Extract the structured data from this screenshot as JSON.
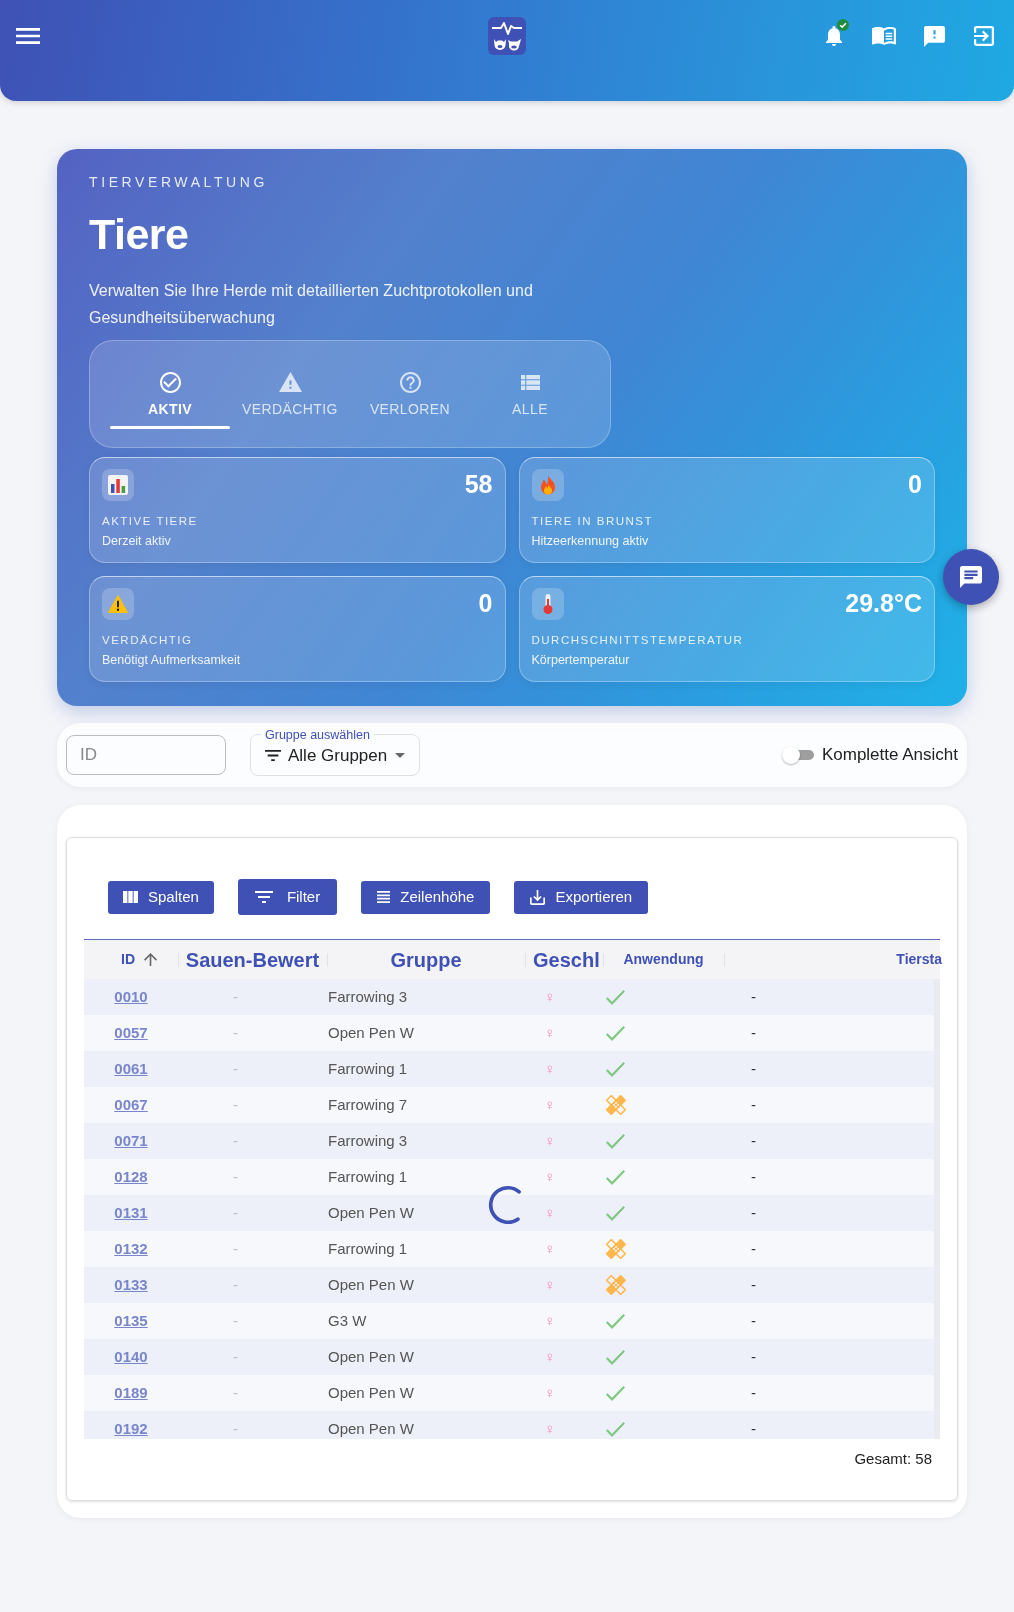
{
  "hero": {
    "eyebrow": "TIERVERWALTUNG",
    "title": "Tiere",
    "description": "Verwalten Sie Ihre Herde mit detaillierten Zuchtprotokollen und Gesundheitsüberwachung",
    "tabs": [
      {
        "label": "AKTIV",
        "selected": true
      },
      {
        "label": "VERDÄCHTIG",
        "selected": false
      },
      {
        "label": "VERLOREN",
        "selected": false
      },
      {
        "label": "ALLE",
        "selected": false
      }
    ],
    "stats": [
      {
        "value": "58",
        "label": "AKTIVE TIERE",
        "caption": "Derzeit aktiv"
      },
      {
        "value": "0",
        "label": "TIERE IN BRUNST",
        "caption": "Hitzeerkennung aktiv"
      },
      {
        "value": "0",
        "label": "VERDÄCHTIG",
        "caption": "Benötigt Aufmerksamkeit"
      },
      {
        "value": "29.8°C",
        "label": "DURCHSCHNITTSTEMPERATUR",
        "caption": "Körpertemperatur"
      }
    ]
  },
  "filters": {
    "id_field": {
      "placeholder": "ID"
    },
    "group_select": {
      "label": "Gruppe auswählen",
      "value": "Alle Gruppen"
    },
    "full_view": {
      "label": "Komplette Ansicht",
      "on": false
    }
  },
  "table": {
    "toolbar": [
      "Spalten",
      "Filter",
      "Zeilenhöhe",
      "Exportieren"
    ],
    "columns": [
      {
        "label": "ID",
        "sorted": true
      },
      {
        "label": "Sauen-Bewert",
        "sorted": false
      },
      {
        "label": "Gruppe",
        "sorted": false
      },
      {
        "label": "Geschl",
        "sorted": false
      },
      {
        "label": "Anwendung",
        "sorted": false
      },
      {
        "label": "Tiersta",
        "sorted": false
      }
    ],
    "rows": [
      {
        "id": "0010",
        "sauen_bewert": "-",
        "gruppe": "Farrowing 3",
        "geschl": "♀",
        "treated": false,
        "column_6": "-"
      },
      {
        "id": "0057",
        "sauen_bewert": "-",
        "gruppe": "Open Pen W",
        "geschl": "♀",
        "treated": false,
        "column_6": "-"
      },
      {
        "id": "0061",
        "sauen_bewert": "-",
        "gruppe": "Farrowing 1",
        "geschl": "♀",
        "treated": false,
        "column_6": "-"
      },
      {
        "id": "0067",
        "sauen_bewert": "-",
        "gruppe": "Farrowing 7",
        "geschl": "♀",
        "treated": true,
        "column_6": "-"
      },
      {
        "id": "0071",
        "sauen_bewert": "-",
        "gruppe": "Farrowing 3",
        "geschl": "♀",
        "treated": false,
        "column_6": "-"
      },
      {
        "id": "0128",
        "sauen_bewert": "-",
        "gruppe": "Farrowing 1",
        "geschl": "♀",
        "treated": false,
        "column_6": "-"
      },
      {
        "id": "0131",
        "sauen_bewert": "-",
        "gruppe": "Open Pen W",
        "geschl": "♀",
        "treated": false,
        "column_6": "-"
      },
      {
        "id": "0132",
        "sauen_bewert": "-",
        "gruppe": "Farrowing 1",
        "geschl": "♀",
        "treated": true,
        "column_6": "-"
      },
      {
        "id": "0133",
        "sauen_bewert": "-",
        "gruppe": "Open Pen W",
        "geschl": "♀",
        "treated": true,
        "column_6": "-"
      },
      {
        "id": "0135",
        "sauen_bewert": "-",
        "gruppe": "G3 W",
        "geschl": "♀",
        "treated": false,
        "column_6": "-"
      },
      {
        "id": "0140",
        "sauen_bewert": "-",
        "gruppe": "Open Pen W",
        "geschl": "♀",
        "treated": false,
        "column_6": "-"
      },
      {
        "id": "0189",
        "sauen_bewert": "-",
        "gruppe": "Open Pen W",
        "geschl": "♀",
        "treated": false,
        "column_6": "-"
      },
      {
        "id": "0192",
        "sauen_bewert": "-",
        "gruppe": "Open Pen W",
        "geschl": "♀",
        "treated": false,
        "column_6": "-"
      }
    ],
    "loading": true,
    "total": "Gesamt: 58"
  }
}
